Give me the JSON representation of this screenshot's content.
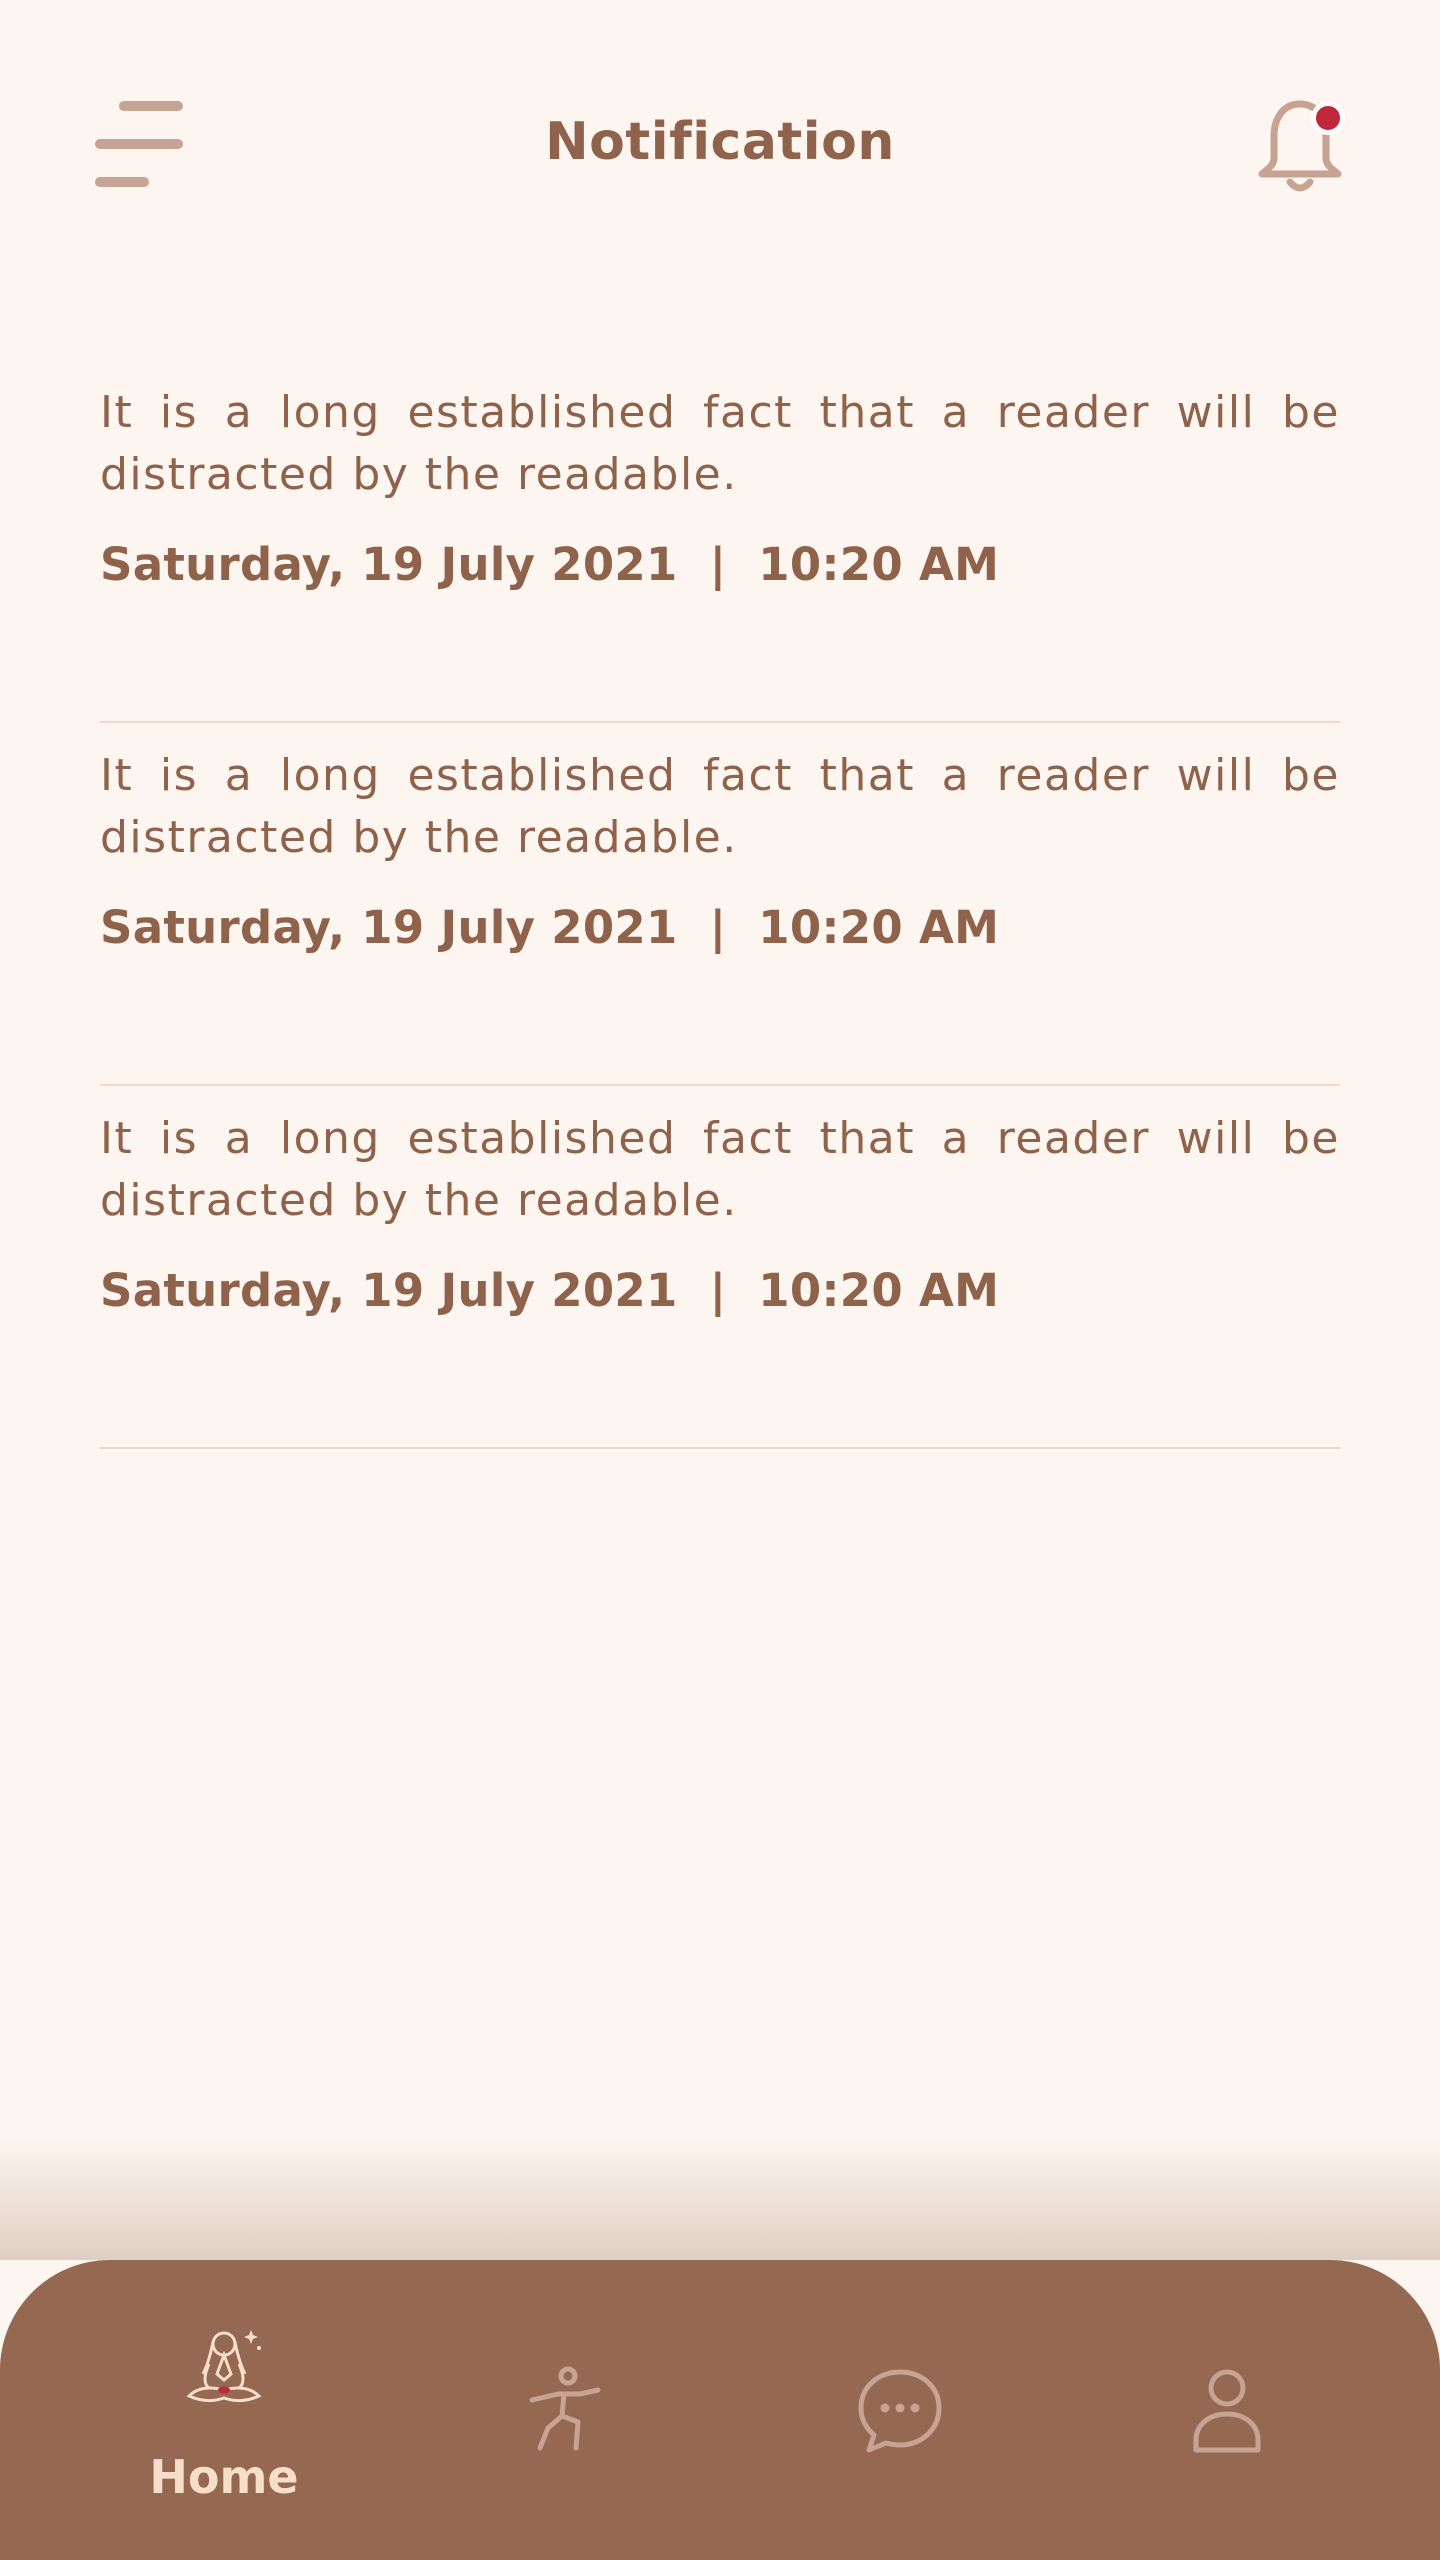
{
  "header": {
    "title": "Notification",
    "menu_icon": "hamburger-menu-icon",
    "bell_icon": "bell-icon",
    "has_unread": true
  },
  "notifications": [
    {
      "message": "It is a long established fact that a reader will be distracted by the readable.",
      "datetime": "Saturday, 19 July 2021  |  10:20 AM"
    },
    {
      "message": "It is a long established fact that a reader will be distracted by the readable.",
      "datetime": "Saturday, 19 July 2021  |  10:20 AM"
    },
    {
      "message": "It is a long established fact that a reader will be distracted by the readable.",
      "datetime": "Saturday, 19 July 2021  |  10:20 AM"
    }
  ],
  "bottom_nav": {
    "items": [
      {
        "label": "Home",
        "icon": "meditation-home-icon",
        "active": true
      },
      {
        "label": "",
        "icon": "yoga-pose-icon",
        "active": false
      },
      {
        "label": "",
        "icon": "chat-bubble-icon",
        "active": false
      },
      {
        "label": "",
        "icon": "profile-icon",
        "active": false
      }
    ]
  },
  "colors": {
    "background": "#fdf5ef",
    "primary_text": "#8f624b",
    "nav_background": "#946851",
    "nav_active_label": "#f6dfca",
    "icon_muted": "#c7a393",
    "unread_dot": "#c0283c",
    "divider": "#efdccb"
  }
}
